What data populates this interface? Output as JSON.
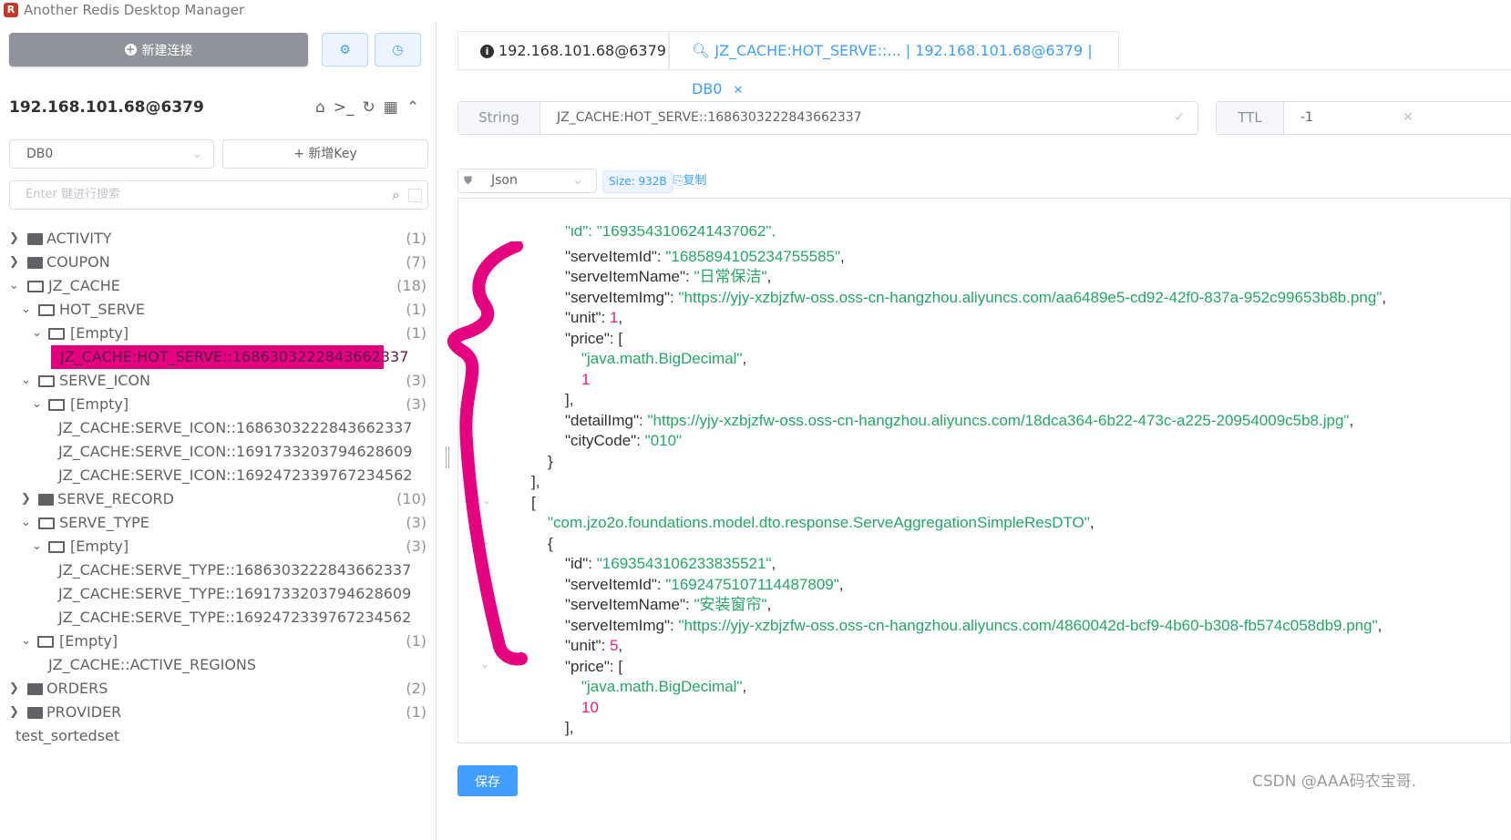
{
  "window": {
    "title": "Another Redis Desktop Manager"
  },
  "toolbar": {
    "new_connection": "新建连接"
  },
  "connection": {
    "name": "192.168.101.68@6379"
  },
  "db": {
    "selected": "DB0"
  },
  "add_key": "+ 新增Key",
  "search": {
    "placeholder": "Enter 键进行搜索"
  },
  "tree": [
    {
      "label": "ACTIVITY",
      "count": "(1)"
    },
    {
      "label": "COUPON",
      "count": "(7)"
    },
    {
      "label": "JZ_CACHE",
      "count": "(18)"
    },
    {
      "label": "HOT_SERVE",
      "count": "(1)"
    },
    {
      "label": "[Empty]",
      "count": "(1)"
    },
    {
      "label": "JZ_CACHE:HOT_SERVE::1686303222843662337",
      "count": ""
    },
    {
      "label": "SERVE_ICON",
      "count": "(3)"
    },
    {
      "label": "[Empty]",
      "count": "(3)"
    },
    {
      "label": "JZ_CACHE:SERVE_ICON::1686303222843662337",
      "count": ""
    },
    {
      "label": "JZ_CACHE:SERVE_ICON::1691733203794628609",
      "count": ""
    },
    {
      "label": "JZ_CACHE:SERVE_ICON::1692472339767234562",
      "count": ""
    },
    {
      "label": "SERVE_RECORD",
      "count": "(10)"
    },
    {
      "label": "SERVE_TYPE",
      "count": "(3)"
    },
    {
      "label": "[Empty]",
      "count": "(3)"
    },
    {
      "label": "JZ_CACHE:SERVE_TYPE::1686303222843662337",
      "count": ""
    },
    {
      "label": "JZ_CACHE:SERVE_TYPE::1691733203794628609",
      "count": ""
    },
    {
      "label": "JZ_CACHE:SERVE_TYPE::1692472339767234562",
      "count": ""
    },
    {
      "label": "[Empty]",
      "count": "(1)"
    },
    {
      "label": "JZ_CACHE::ACTIVE_REGIONS",
      "count": ""
    },
    {
      "label": "ORDERS",
      "count": "(2)"
    },
    {
      "label": "PROVIDER",
      "count": "(1)"
    },
    {
      "label": "test_sortedset",
      "count": ""
    }
  ],
  "tabs": [
    {
      "label": "192.168.101.68@6379"
    },
    {
      "label": "JZ_CACHE:HOT_SERVE::... | 192.168.101.68@6379 | DB0"
    }
  ],
  "key_panel": {
    "type": "String",
    "key": "JZ_CACHE:HOT_SERVE::1686303222843662337",
    "ttl_label": "TTL",
    "ttl_value": "-1"
  },
  "view": {
    "format": "Json",
    "size": "Size: 932B",
    "copy": "复制"
  },
  "code_lines": [
    {
      "t": "\"id\": \"1693543106241437062\",",
      "ind": 0
    },
    {
      "k": "\"serveItemId\": ",
      "s": "\"1685894105234755585\"",
      "e": ","
    },
    {
      "k": "\"serveItemName\": ",
      "s": "\"日常保洁\"",
      "e": ","
    },
    {
      "k": "\"serveItemImg\": ",
      "s": "\"https://yjy-xzbjzfw-oss.oss-cn-hangzhou.aliyuncs.com/aa6489e5-cd92-42f0-837a-952c99653b8b.png\"",
      "e": ","
    },
    {
      "k": "\"unit\": ",
      "n": "1",
      "e": ","
    },
    {
      "k": "\"price\": [",
      "e": ""
    },
    {
      "s": "\"java.math.BigDecimal\"",
      "e": ","
    },
    {
      "n": "1"
    },
    {
      "k": "],",
      "e": ""
    },
    {
      "k": "\"detailImg\": ",
      "s": "\"https://yjy-xzbjzfw-oss.oss-cn-hangzhou.aliyuncs.com/18dca364-6b22-473c-a225-20954009c5b8.jpg\"",
      "e": ","
    },
    {
      "k": "\"cityCode\": ",
      "s": "\"010\"",
      "e": ""
    },
    {
      "k": "}",
      "e": ""
    },
    {
      "k": "],",
      "e": ""
    },
    {
      "k": "[",
      "e": ""
    },
    {
      "s": "\"com.jzo2o.foundations.model.dto.response.ServeAggregationSimpleResDTO\"",
      "e": ","
    },
    {
      "k": "{",
      "e": ""
    },
    {
      "k": "\"id\": ",
      "s": "\"1693543106233835521\"",
      "e": ","
    },
    {
      "k": "\"serveItemId\": ",
      "s": "\"1692475107114487809\"",
      "e": ","
    },
    {
      "k": "\"serveItemName\": ",
      "s": "\"安装窗帘\"",
      "e": ","
    },
    {
      "k": "\"serveItemImg\": ",
      "s": "\"https://yjy-xzbjzfw-oss.oss-cn-hangzhou.aliyuncs.com/4860042d-bcf9-4b60-b308-fb574c058db9.png\"",
      "e": ","
    },
    {
      "k": "\"unit\": ",
      "n": "5",
      "e": ","
    },
    {
      "k": "\"price\": [",
      "e": ""
    },
    {
      "s": "\"java.math.BigDecimal\"",
      "e": ","
    },
    {
      "n": "10"
    },
    {
      "k": "],",
      "e": ""
    }
  ],
  "save_button": "保存",
  "watermark": "CSDN @AAA码农宝哥.",
  "colors": {
    "accent": "#409eff",
    "highlight": "#e4007f",
    "json_string": "#27a567",
    "json_number": "#e6227a"
  }
}
